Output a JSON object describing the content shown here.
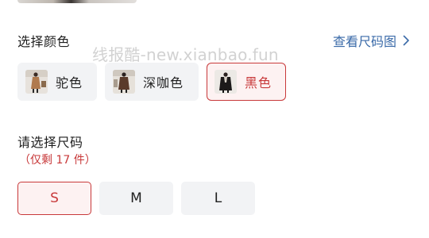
{
  "watermark": "线报酷-new.xianbao.fun",
  "color_section": {
    "title": "选择颜色",
    "size_guide_link": "查看尺码图",
    "options": [
      {
        "label": "驼色",
        "selected": false
      },
      {
        "label": "深咖色",
        "selected": false
      },
      {
        "label": "黑色",
        "selected": true
      }
    ]
  },
  "size_section": {
    "title": "请选择尺码",
    "stock_note": "（仅剩 17 件）",
    "options": [
      {
        "label": "S",
        "selected": true
      },
      {
        "label": "M",
        "selected": false
      },
      {
        "label": "L",
        "selected": false
      }
    ]
  },
  "colors": {
    "accent": "#c8393a",
    "link": "#3a6aa8",
    "chip_bg": "#f2f3f5",
    "chip_selected_bg": "#fdf2f2"
  }
}
